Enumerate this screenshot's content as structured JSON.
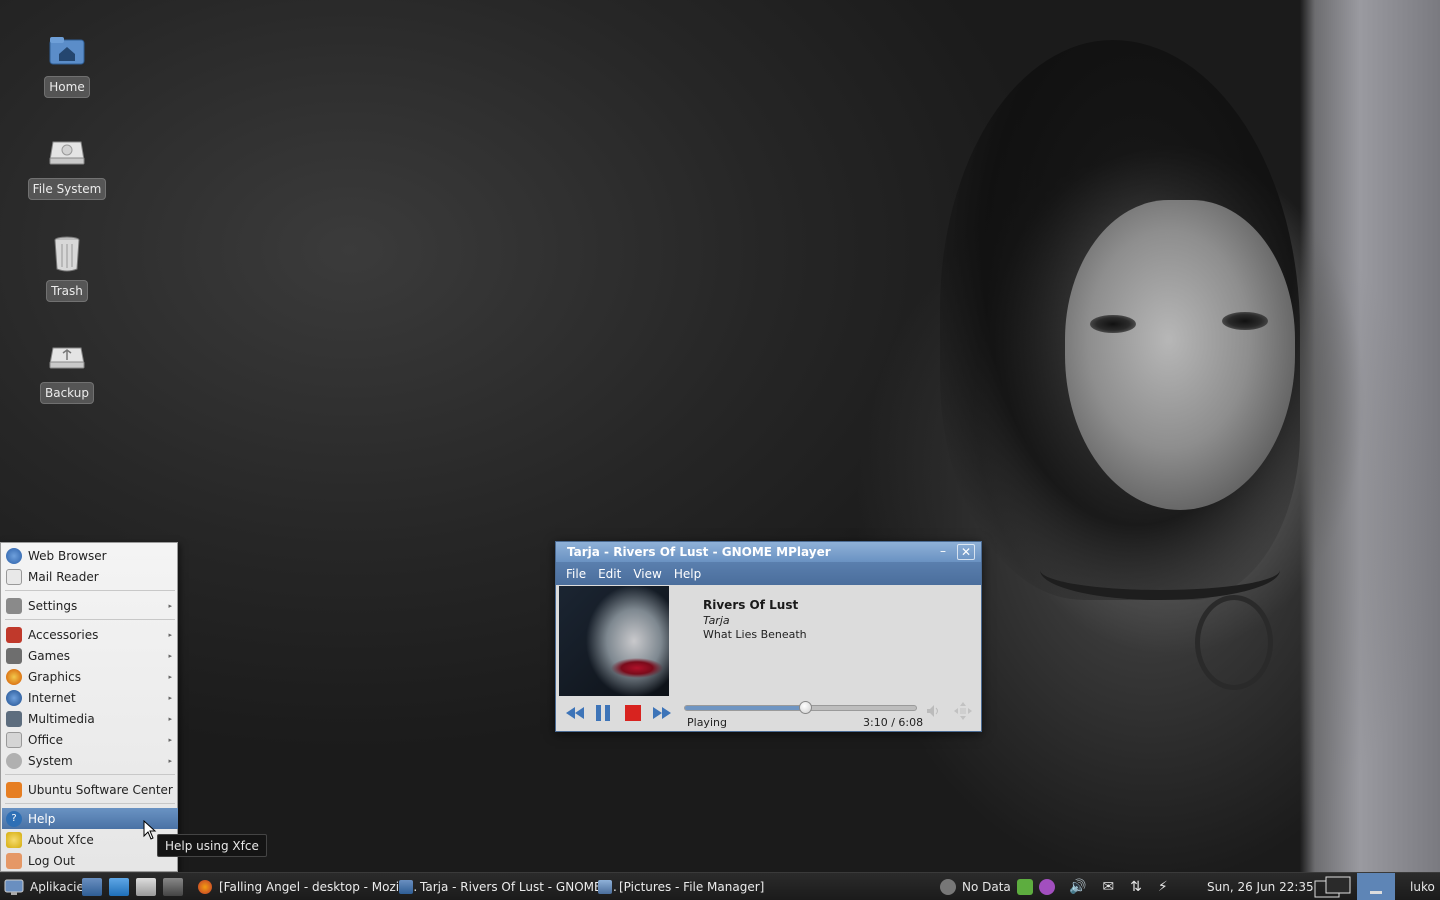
{
  "desktop": {
    "icons": [
      {
        "label": "Home",
        "icon": "home-folder-icon"
      },
      {
        "label": "File System",
        "icon": "drive-icon"
      },
      {
        "label": "Trash",
        "icon": "trash-icon"
      },
      {
        "label": "Backup",
        "icon": "backup-drive-icon"
      }
    ]
  },
  "menu": {
    "items": {
      "web_browser": "Web Browser",
      "mail_reader": "Mail Reader",
      "settings": "Settings",
      "accessories": "Accessories",
      "games": "Games",
      "graphics": "Graphics",
      "internet": "Internet",
      "multimedia": "Multimedia",
      "office": "Office",
      "system": "System",
      "software_center": "Ubuntu Software Center",
      "help": "Help",
      "about": "About Xfce",
      "logout": "Log Out"
    },
    "submenu_arrow": "▸",
    "tooltip": "Help using Xfce"
  },
  "player": {
    "title": "Tarja - Rivers Of Lust - GNOME MPlayer",
    "menus": [
      "File",
      "Edit",
      "View",
      "Help"
    ],
    "track": {
      "title": "Rivers Of Lust",
      "artist": "Tarja",
      "album": "What Lies Beneath"
    },
    "status": "Playing",
    "time": "3:10 /  6:08",
    "progress_fraction": 0.52,
    "accent": "#6f95c2"
  },
  "taskbar": {
    "start_label": "Aplikacie",
    "tasks": [
      "[Falling Angel - desktop - Mozill...",
      "Tarja - Rivers Of Lust - GNOME ...",
      "[Pictures - File Manager]"
    ],
    "weather": "No Data",
    "datetime": "Sun, 26 Jun  22:35",
    "user": "luko"
  }
}
